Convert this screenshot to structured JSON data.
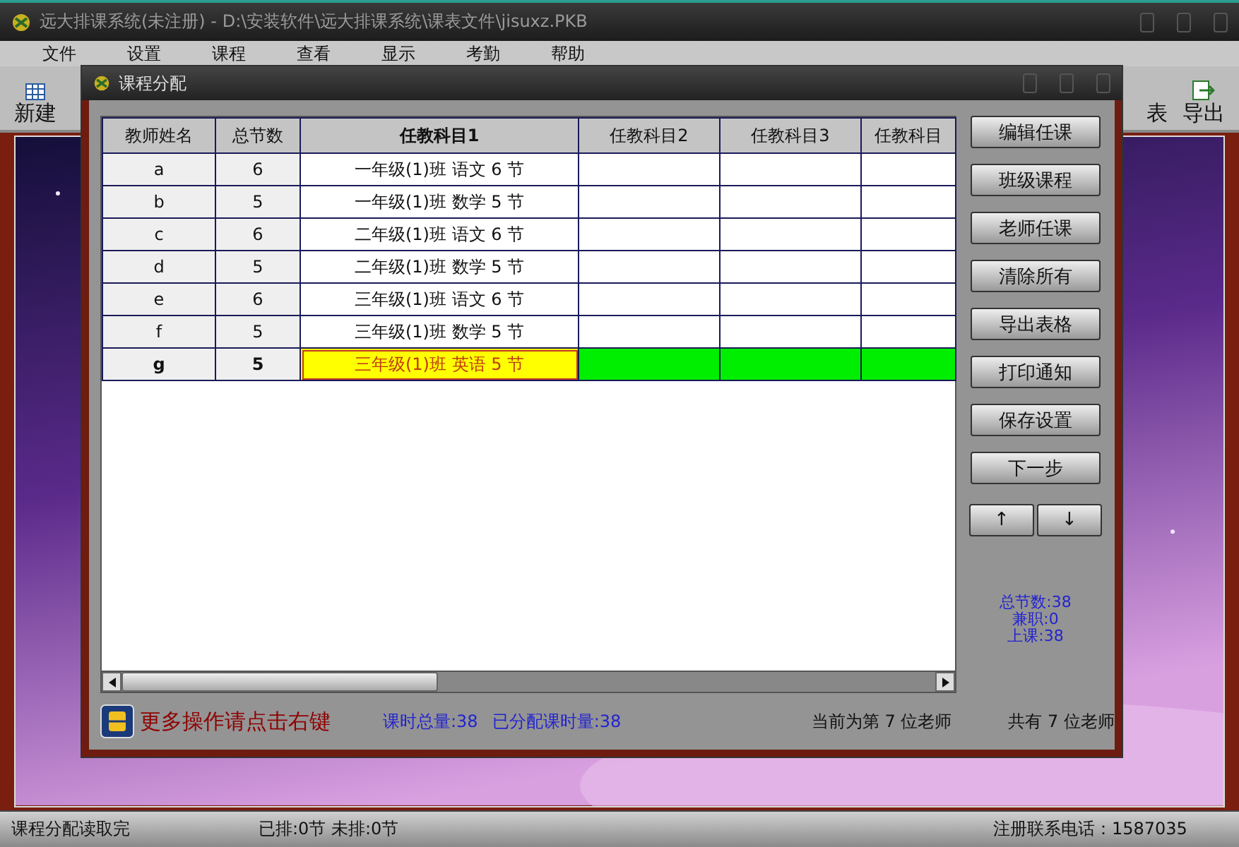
{
  "window": {
    "title": "远大排课系统(未注册) - D:\\安装软件\\远大排课系统\\课表文件\\jisuxz.PKB"
  },
  "menu": [
    "文件",
    "设置",
    "课程",
    "查看",
    "显示",
    "考勤",
    "帮助"
  ],
  "toolbar": {
    "left": [
      {
        "label": "新建",
        "kind": "grid"
      }
    ],
    "right": [
      {
        "label": "表",
        "kind": "none"
      },
      {
        "label": "导出",
        "kind": "export"
      }
    ]
  },
  "dialog": {
    "title": "课程分配",
    "table": {
      "columns": [
        {
          "label": "教师姓名",
          "active": false
        },
        {
          "label": "总节数",
          "active": false
        },
        {
          "label": "任教科目1",
          "active": true
        },
        {
          "label": "任教科目2",
          "active": false
        },
        {
          "label": "任教科目3",
          "active": false
        },
        {
          "label": "任教科目",
          "active": false
        }
      ],
      "rows": [
        {
          "name": "a",
          "total": "6",
          "subject_1": "一年级(1)班 语文 6 节",
          "selected": false
        },
        {
          "name": "b",
          "total": "5",
          "subject_1": "一年级(1)班 数学 5 节",
          "selected": false
        },
        {
          "name": "c",
          "total": "6",
          "subject_1": "二年级(1)班 语文 6 节",
          "selected": false
        },
        {
          "name": "d",
          "total": "5",
          "subject_1": "二年级(1)班 数学 5 节",
          "selected": false
        },
        {
          "name": "e",
          "total": "6",
          "subject_1": "三年级(1)班 语文 6 节",
          "selected": false
        },
        {
          "name": "f",
          "total": "5",
          "subject_1": "三年级(1)班 数学 5 节",
          "selected": false
        },
        {
          "name": "g",
          "total": "5",
          "subject_1": "三年级(1)班 英语 5 节",
          "selected": true
        }
      ]
    },
    "buttons": [
      "编辑任课",
      "班级课程",
      "老师任课",
      "清除所有",
      "导出表格",
      "打印通知",
      "保存设置",
      "下一步"
    ],
    "arrows": [
      "↑",
      "↓"
    ],
    "stats": [
      "总节数:38",
      "兼职:0",
      "上课:38"
    ],
    "hint": "更多操作请点击右键",
    "totals": [
      "课时总量:38",
      "已分配课时量:38"
    ],
    "current": "当前为第 7 位老师",
    "count": "共有 7 位老师"
  },
  "status_bar": [
    "课程分配读取完",
    "已排:0节 未排:0节",
    "注册联系电话：1587035"
  ]
}
